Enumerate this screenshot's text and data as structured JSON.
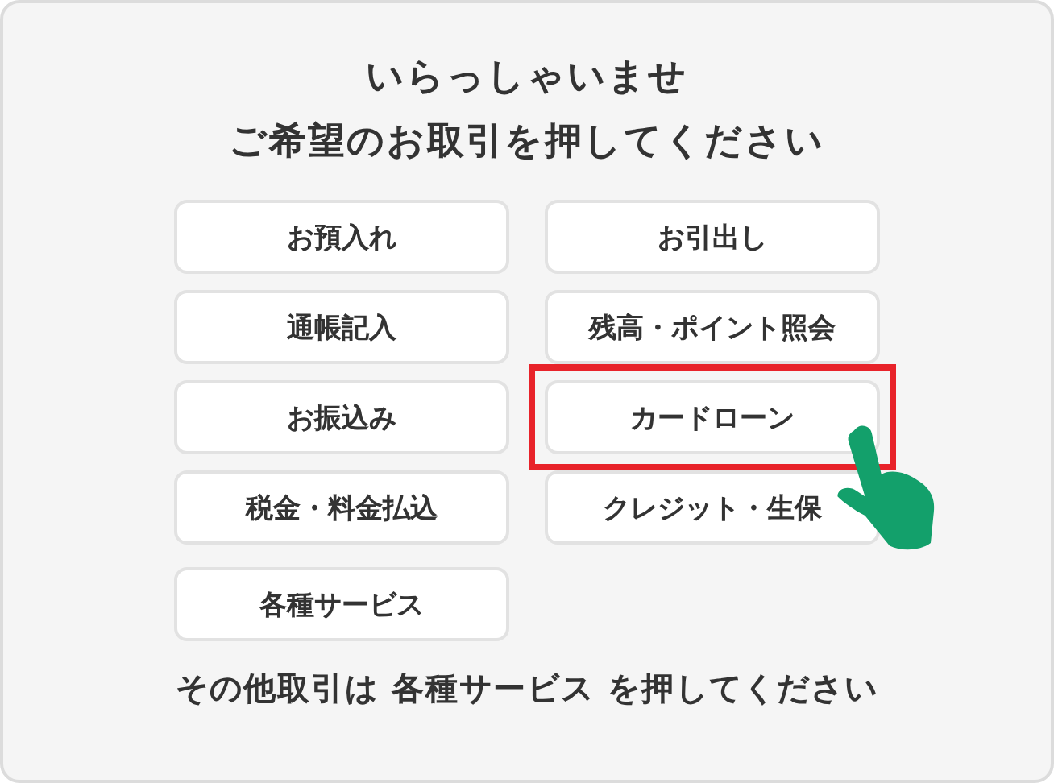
{
  "title_lines": [
    "いらっしゃいませ",
    "ご希望のお取引を押してください"
  ],
  "buttons": [
    {
      "label": "お預入れ",
      "selected": false
    },
    {
      "label": "お引出し",
      "selected": false
    },
    {
      "label": "通帳記入",
      "selected": false
    },
    {
      "label": "残高・ポイント照会",
      "selected": false
    },
    {
      "label": "お振込み",
      "selected": false
    },
    {
      "label": "カードローン",
      "selected": true
    },
    {
      "label": "税金・料金払込",
      "selected": false
    },
    {
      "label": "クレジット・生保",
      "selected": false
    }
  ],
  "extra_button": {
    "label": "各種サービス",
    "selected": false
  },
  "footer": "その他取引は 各種サービス を押してください"
}
